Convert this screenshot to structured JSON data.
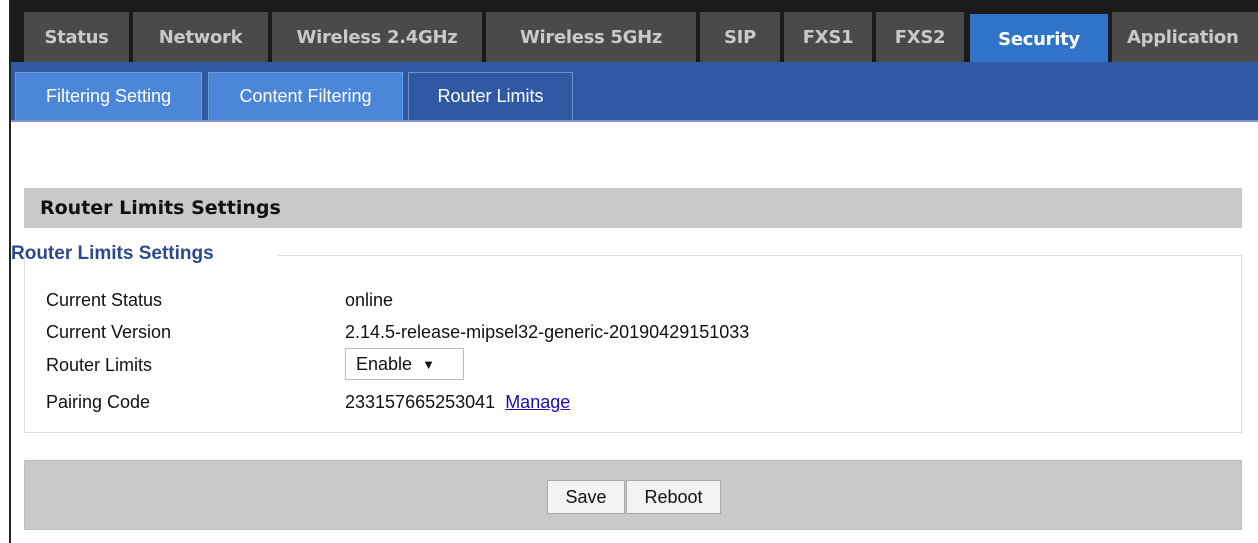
{
  "top_tabs": [
    {
      "label": "Status"
    },
    {
      "label": "Network"
    },
    {
      "label": "Wireless 2.4GHz"
    },
    {
      "label": "Wireless 5GHz"
    },
    {
      "label": "SIP"
    },
    {
      "label": "FXS1"
    },
    {
      "label": "FXS2"
    },
    {
      "label": "Security",
      "active": true
    },
    {
      "label": "Application"
    }
  ],
  "sub_tabs": [
    {
      "label": "Filtering Setting"
    },
    {
      "label": "Content Filtering"
    },
    {
      "label": "Router Limits",
      "active": true
    }
  ],
  "section": {
    "title": "Router Limits Settings"
  },
  "fieldset": {
    "legend": "Router Limits Settings",
    "rows": [
      {
        "label": "Current Status",
        "value": "online"
      },
      {
        "label": "Current Version",
        "value": "2.14.5-release-mipsel32-generic-20190429151033"
      },
      {
        "label": "Router Limits",
        "value": "Enable"
      },
      {
        "label": "Pairing Code",
        "value": "233157665253041",
        "link": "Manage"
      }
    ]
  },
  "buttons": {
    "save": "Save",
    "reboot": "Reboot"
  },
  "colors": {
    "active_tab": "#2f74c8",
    "sub_bar": "#2f5aa3",
    "legend": "#2c4a8c",
    "link": "#1a0dab"
  }
}
